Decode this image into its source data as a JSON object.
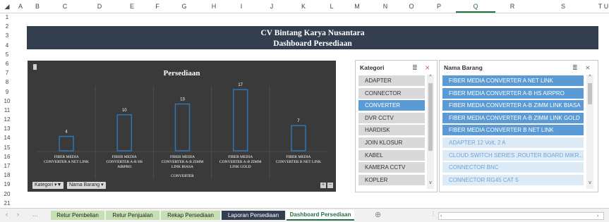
{
  "columns": [
    "A",
    "B",
    "C",
    "D",
    "E",
    "F",
    "G",
    "H",
    "I",
    "J",
    "K",
    "L",
    "M",
    "N",
    "O",
    "P",
    "Q",
    "R",
    "S",
    "T",
    "U"
  ],
  "rows": [
    "1",
    "2",
    "3",
    "4",
    "5",
    "6",
    "7",
    "8",
    "9",
    "10",
    "11",
    "12",
    "13",
    "14",
    "15",
    "16",
    "17",
    "18",
    "19",
    "20",
    "21"
  ],
  "banner": {
    "title": "CV Bintang Karya Nusantara",
    "subtitle": "Dashboard Persediaan"
  },
  "chart_data": {
    "type": "bar",
    "title": "Persediaan",
    "categories": [
      "FIBER MEDIA CONVERTER A NET LINK",
      "FIBER MEDIA CONVERTER A-B HS AIRPRO",
      "FIBER MEDIA CONVERTER A-B ZIMM LINK BIASA",
      "FIBER MEDIA CONVERTER A-B ZIMM LINK GOLD",
      "FIBER MEDIA CONVERTER B NET LINK"
    ],
    "category_lines": [
      [
        "FIBER MEDIA",
        "CONVERTER A NET LINK"
      ],
      [
        "FIBER MEDIA",
        "CONVERTER A-B HS",
        "AIRPRO"
      ],
      [
        "FIBER MEDIA",
        "CONVERTER A-B ZIMM",
        "LINK BIASA"
      ],
      [
        "FIBER MEDIA",
        "CONVERTER A-B ZIMM",
        "LINK GOLD"
      ],
      [
        "FIBER MEDIA",
        "CONVERTER B NET LINK"
      ]
    ],
    "group_label": "CONVERTER",
    "values": [
      4,
      10,
      13,
      17,
      7
    ],
    "ylim": [
      0,
      18
    ],
    "grid": true,
    "colors": {
      "background": "#3a3a3a",
      "bar_fill": "#3a3a3a",
      "bar_stroke": "#2e75b6",
      "text": "#ffffff",
      "grid": "#4d4d4d"
    }
  },
  "chart_controls": {
    "kategori_btn": "Kategori ▾▼",
    "nama_btn": "Nama Barang ▾",
    "plus": "+",
    "minus": "−"
  },
  "slicer_kategori": {
    "header": "Kategori",
    "items": [
      {
        "label": "ADAPTER",
        "selected": false
      },
      {
        "label": "CONNECTOR",
        "selected": false
      },
      {
        "label": "CONVERTER",
        "selected": true
      },
      {
        "label": "DVR CCTV",
        "selected": false
      },
      {
        "label": "HARDISK",
        "selected": false
      },
      {
        "label": "JOIN KLOSUR",
        "selected": false
      },
      {
        "label": "KABEL",
        "selected": false
      },
      {
        "label": "KAMERA CCTV",
        "selected": false
      },
      {
        "label": "KOPLER",
        "selected": false
      }
    ]
  },
  "slicer_nama": {
    "header": "Nama Barang",
    "items": [
      {
        "label": "FIBER MEDIA CONVERTER A NET LINK",
        "state": "selected"
      },
      {
        "label": "FIBER MEDIA CONVERTER A-B HS AIRPRO",
        "state": "selected"
      },
      {
        "label": "FIBER MEDIA CONVERTER A-B ZIMM LINK BIASA",
        "state": "selected"
      },
      {
        "label": "FIBER MEDIA CONVERTER A-B ZIMM LINK GOLD",
        "state": "selected"
      },
      {
        "label": "FIBER MEDIA CONVERTER B NET LINK",
        "state": "selected"
      },
      {
        "label": "ADAPTER 12 Volt, 2 A",
        "state": "nodata"
      },
      {
        "label": "CLOUD SWITCH SERIES ,ROUTER BOARD MIKR...",
        "state": "nodata"
      },
      {
        "label": "CONNECTOR BNC",
        "state": "nodata"
      },
      {
        "label": "CONNECTOR RG45 CAT 5",
        "state": "nodata"
      }
    ]
  },
  "icons": {
    "multiselect": "≣",
    "clear_filter": "⨯",
    "up": "^",
    "down": "v",
    "prev": "‹",
    "next": "›",
    "ellipsis": "...",
    "add_sheet": "⊕"
  },
  "tabs": [
    {
      "label": "Retur Pembelian",
      "color": "#c6e0b4",
      "text": "#222"
    },
    {
      "label": "Retur Penjualan",
      "color": "#c6e0b4",
      "text": "#222"
    },
    {
      "label": "Rekap Persediaan",
      "color": "#c6e0b4",
      "text": "#222"
    },
    {
      "label": "Laporan Persediaan",
      "color": "#333f4f",
      "text": "#ffffff"
    },
    {
      "label": "Dashboard Persediaan",
      "color": "#ffffff",
      "text": "#217346",
      "active": true
    }
  ]
}
